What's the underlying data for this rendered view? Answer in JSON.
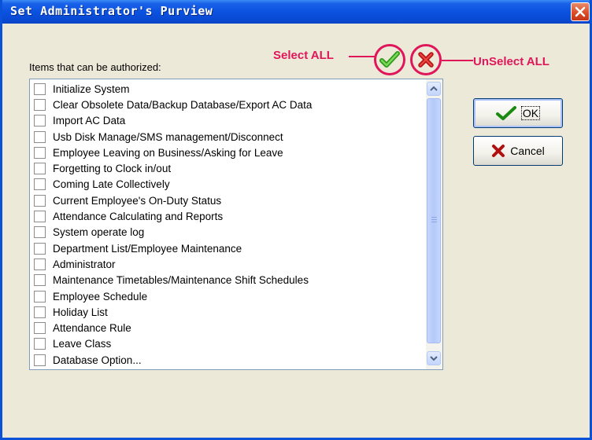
{
  "window": {
    "title": "Set Administrator's Purview"
  },
  "list": {
    "label": "Items that can be authorized:",
    "items": [
      "Initialize System",
      "Clear Obsolete Data/Backup Database/Export AC Data",
      "Import AC Data",
      "Usb Disk Manage/SMS management/Disconnect",
      "Employee Leaving on Business/Asking for Leave",
      "Forgetting to Clock in/out",
      "Coming Late Collectively",
      "Current Employee's On-Duty Status",
      "Attendance Calculating and Reports",
      "System operate log",
      "Department List/Employee Maintenance",
      "Administrator",
      "Maintenance Timetables/Maintenance Shift Schedules",
      "Employee Schedule",
      "Holiday List",
      "Attendance Rule",
      "Leave Class",
      "Database Option..."
    ]
  },
  "buttons": {
    "ok_label": "OK",
    "cancel_label": "Cancel"
  },
  "annotations": {
    "select_all": "Select ALL",
    "unselect_all": "UnSelect ALL"
  },
  "colors": {
    "annotation": "#e0165a",
    "titlebar": "#0b52e0"
  },
  "icons": {
    "select_all": "green-check-icon",
    "unselect_all": "red-x-icon"
  }
}
